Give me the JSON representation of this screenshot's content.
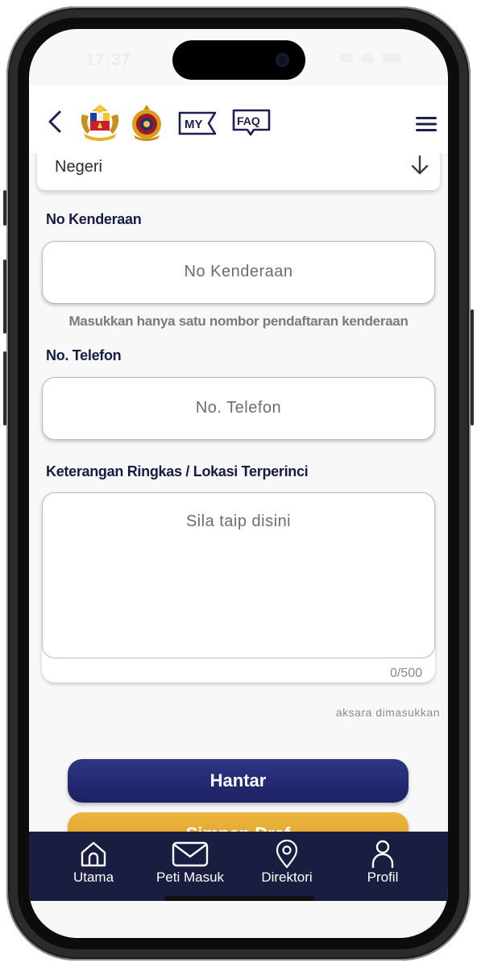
{
  "status_bar": {
    "time": "17:37"
  },
  "header": {
    "back_icon": "chevron-left-icon",
    "logo_primary": "malaysia-coat-of-arms",
    "logo_secondary": "agency-crest",
    "my_label": "MY",
    "faq_label": "FAQ",
    "menu_icon": "hamburger-icon"
  },
  "form": {
    "state_select": {
      "value": "Negeri",
      "icon": "arrow-down-icon"
    },
    "vehicle": {
      "label": "No Kenderaan",
      "placeholder": "No Kenderaan",
      "helper": "Masukkan hanya satu nombor pendaftaran kenderaan"
    },
    "phone": {
      "label": "No. Telefon",
      "placeholder": "No. Telefon"
    },
    "description": {
      "label": "Keterangan Ringkas / Lokasi Terperinci",
      "placeholder": "Sila taip disini",
      "counter": "0/500",
      "counter_note": "aksara dimasukkan"
    },
    "submit_label": "Hantar",
    "draft_label": "Simpan Draf"
  },
  "tabbar": {
    "items": [
      {
        "label": "Utama",
        "icon": "home-icon"
      },
      {
        "label": "Peti Masuk",
        "icon": "mail-icon"
      },
      {
        "label": "Direktori",
        "icon": "location-pin-icon"
      },
      {
        "label": "Profil",
        "icon": "person-icon"
      }
    ]
  },
  "colors": {
    "navy": "#191d40",
    "primary_button": "#252b73",
    "accent_button": "#e3aa35",
    "label_text": "#171c45"
  }
}
